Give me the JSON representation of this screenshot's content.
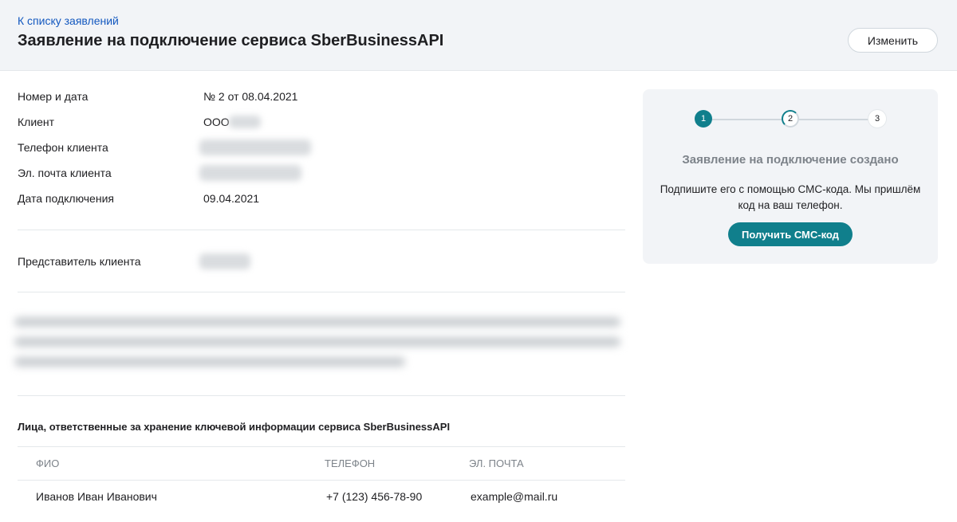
{
  "header": {
    "back_link": "К списку заявлений",
    "title": "Заявление на подключение сервиса SberBusinessAPI",
    "edit_label": "Изменить"
  },
  "details": {
    "number_label": "Номер и дата",
    "number_value": "№ 2 от 08.04.2021",
    "client_label": "Клиент",
    "client_value": "ООО",
    "phone_label": "Телефон клиента",
    "email_label": "Эл. почта клиента",
    "connect_date_label": "Дата подключения",
    "connect_date_value": "09.04.2021",
    "representative_label": "Представитель клиента"
  },
  "keys_section": {
    "title": "Лица, ответственные за хранение ключевой информации сервиса SberBusinessAPI",
    "columns": [
      "ФИО",
      "Телефон",
      "Эл. почта"
    ],
    "rows": [
      {
        "name": "Иванов Иван Иванович",
        "phone": "+7 (123) 456-78-90",
        "email": "example@mail.ru"
      }
    ]
  },
  "status_card": {
    "steps": [
      "1",
      "2",
      "3"
    ],
    "current_step": 1,
    "title": "Заявление на подключение создано",
    "text": "Подпишите его с помощью СМС-кода. Мы пришлём код на ваш телефон.",
    "button_label": "Получить СМС-код"
  },
  "colors": {
    "accent": "#107f8c",
    "link": "#1358bf",
    "header_bg": "#f2f4f7",
    "muted_text": "#7d838a"
  }
}
